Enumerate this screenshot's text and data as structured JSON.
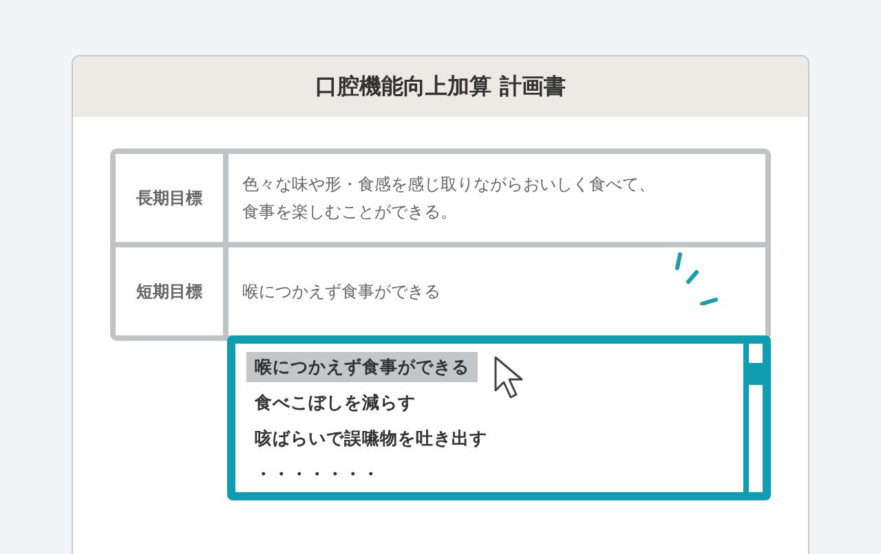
{
  "title": "口腔機能向上加算 計画書",
  "goals": [
    {
      "label": "長期目標",
      "lines": [
        "色々な味や形・食感を感じ取りながらおいしく食べて、",
        "食事を楽しむことができる。"
      ]
    },
    {
      "label": "短期目標",
      "lines": [
        "喉につかえず食事ができる"
      ]
    }
  ],
  "options": [
    {
      "text": "喉につかえず食事ができる",
      "selected": true
    },
    {
      "text": "食べこぼしを減らす",
      "selected": false
    },
    {
      "text": "咳ばらいで誤嚥物を吐き出す",
      "selected": false
    },
    {
      "text": "・・・・・・・",
      "selected": false
    }
  ]
}
